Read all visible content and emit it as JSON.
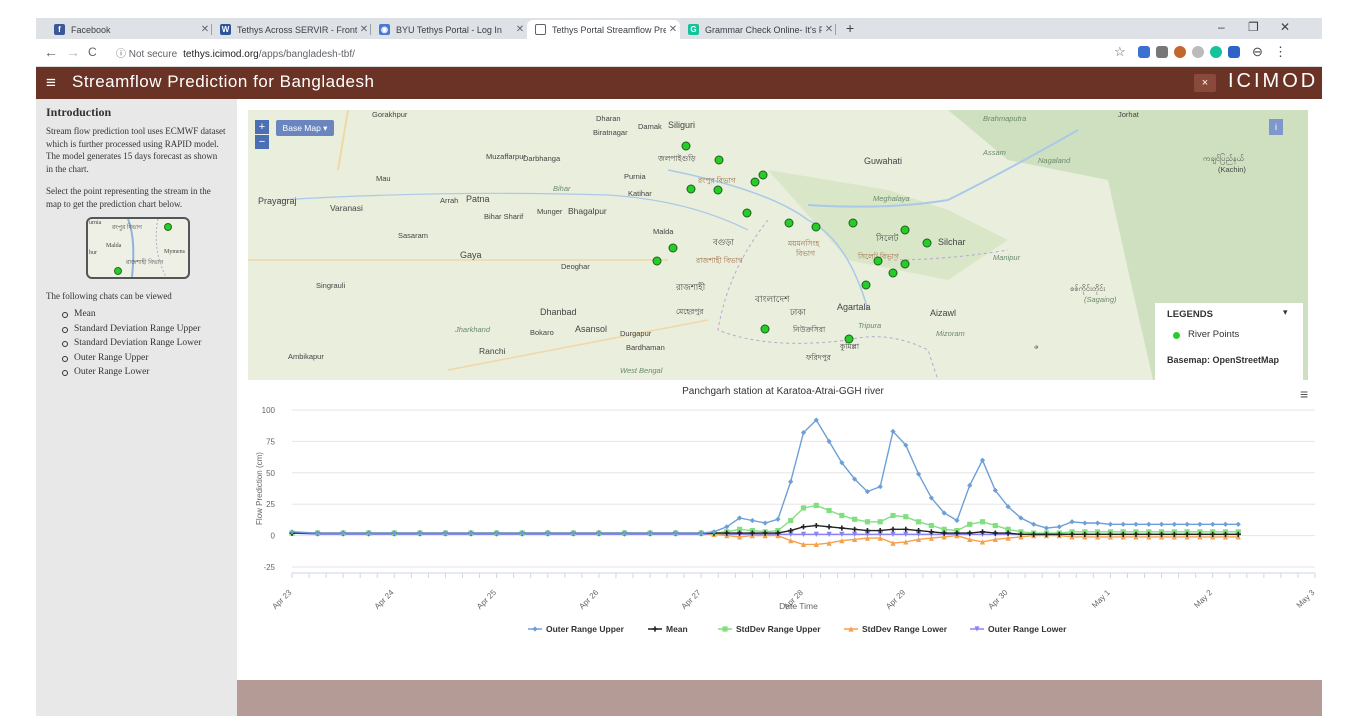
{
  "browser": {
    "tabs": [
      {
        "label": "Facebook",
        "icon": "facebook-icon",
        "color": "#3b5998",
        "glyph": "f"
      },
      {
        "label": "Tethys Across SERVIR - Frontiers",
        "icon": "word-doc-icon",
        "color": "#2b579a",
        "glyph": "W"
      },
      {
        "label": "BYU Tethys Portal - Log In",
        "icon": "globe-icon",
        "color": "#4a7bd0",
        "glyph": "◉"
      },
      {
        "label": "Tethys Portal Streamflow Predicti",
        "icon": "page-icon",
        "color": "#ffffff",
        "glyph": ""
      },
      {
        "label": "Grammar Check Online- It's Free",
        "icon": "grammar-icon",
        "color": "#15c39a",
        "glyph": "G"
      }
    ],
    "new_tab": "+",
    "win_min": "–",
    "win_restore": "❐",
    "win_close": "✕",
    "nav_back": "←",
    "nav_forward": "→",
    "nav_reload": "C",
    "not_secure": "ⓘ Not secure",
    "url_host": "tethys.icimod.org",
    "url_path": "/apps/bangladesh-tbf/",
    "star": "☆",
    "profile": "⊖",
    "kebab": "⋮"
  },
  "app": {
    "menu_glyph": "≡",
    "title": "Streamflow Prediction for Bangladesh",
    "close_glyph": "×",
    "logo": "ICIMOD"
  },
  "sidebar": {
    "heading": "Introduction",
    "para1": "Stream flow prediction tool uses ECMWF dataset which is further processed using RAPID model. The model generates 15 days forecast as shown in the chart.",
    "para2": "Select the point representing the stream in the map to get the prediction chart below.",
    "thumb_labels": [
      "urnia",
      "রংপুর বিভাগ",
      "bur",
      "Malda",
      "রাজশাহী বিভাগ",
      "Mymens"
    ],
    "para3": "The following chats can be viewed",
    "items": [
      "Mean",
      "Standard Deviation Range Upper",
      "Standard Deviation Range Lower",
      "Outer Range Upper",
      "Outer Range Lower"
    ]
  },
  "map": {
    "zoom_in": "+",
    "zoom_out": "−",
    "basemap_button": "Base Map ▾",
    "info_button": "i",
    "legend_title": "LEGENDS",
    "legend_caret": "▾",
    "legend_item": "River Points",
    "basemap_text": "Basemap: OpenStreetMap",
    "point_color": "#27cd27",
    "labels": [
      {
        "t": "Gorakhpur",
        "it": false
      },
      {
        "t": "Dharan",
        "it": false
      },
      {
        "t": "Damak",
        "it": false
      },
      {
        "t": "Siliguri",
        "it": false
      },
      {
        "t": "Biratnagar",
        "it": false
      },
      {
        "t": "Brahmaputra",
        "it": true
      },
      {
        "t": "Jorhat",
        "it": false
      },
      {
        "t": "জলপাইগুড়ি",
        "it": false
      },
      {
        "t": "Muzaffarpur",
        "it": false
      },
      {
        "t": "Darbhanga",
        "it": false
      },
      {
        "t": "Purnia",
        "it": false
      },
      {
        "t": "Guwahati",
        "it": false
      },
      {
        "t": "Assam",
        "it": true
      },
      {
        "t": "Nagaland",
        "it": true
      },
      {
        "t": "Mau",
        "it": false
      },
      {
        "t": "রংপুর বিভাগ",
        "it": false
      },
      {
        "t": "Bihar",
        "it": true
      },
      {
        "t": "Katihar",
        "it": false
      },
      {
        "t": "ကချင်ပြည်နယ်",
        "it": false
      },
      {
        "t": "(Kachin)",
        "it": false
      },
      {
        "t": "Prayagraj",
        "it": false
      },
      {
        "t": "Varanasi",
        "it": false
      },
      {
        "t": "Arrah",
        "it": false
      },
      {
        "t": "Patna",
        "it": false
      },
      {
        "t": "Meghalaya",
        "it": true
      },
      {
        "t": "Bihar Sharif",
        "it": false
      },
      {
        "t": "Munger",
        "it": false
      },
      {
        "t": "Bhagalpur",
        "it": false
      },
      {
        "t": "Sasaram",
        "it": false
      },
      {
        "t": "Malda",
        "it": false
      },
      {
        "t": "বগুড়া",
        "it": false
      },
      {
        "t": "ময়মনসিংহ",
        "it": false
      },
      {
        "t": "বিভাগ",
        "it": false
      },
      {
        "t": "সিলেট",
        "it": false
      },
      {
        "t": "Silchar",
        "it": false
      },
      {
        "t": "Gaya",
        "it": false
      },
      {
        "t": "রাজশাহী বিভাগ",
        "it": false
      },
      {
        "t": "সিলেট বিভাগ",
        "it": false
      },
      {
        "t": "Manipur",
        "it": true
      },
      {
        "t": "Deoghar",
        "it": false
      },
      {
        "t": "Singrauli",
        "it": false
      },
      {
        "t": "রাজশাহী",
        "it": false
      },
      {
        "t": "বাংলাদেশ",
        "it": false
      },
      {
        "t": "Dhanbad",
        "it": false
      },
      {
        "t": "মেহেরপুর",
        "it": false
      },
      {
        "t": "ঢাকা",
        "it": false
      },
      {
        "t": "Agartala",
        "it": false
      },
      {
        "t": "Aizawl",
        "it": false
      },
      {
        "t": "Jharkhand",
        "it": true
      },
      {
        "t": "Bokaro",
        "it": false
      },
      {
        "t": "Asansol",
        "it": false
      },
      {
        "t": "Durgapur",
        "it": false
      },
      {
        "t": "নিউক্রসিরা",
        "it": false
      },
      {
        "t": "Tripura",
        "it": true
      },
      {
        "t": "Mizoram",
        "it": true
      },
      {
        "t": "Ranchi",
        "it": false
      },
      {
        "t": "Bardhaman",
        "it": false
      },
      {
        "t": "কুমিল্লা",
        "it": false
      },
      {
        "t": "Ambikapur",
        "it": false
      },
      {
        "t": "ফরিদপুর",
        "it": false
      },
      {
        "t": "West Bengal",
        "it": true
      },
      {
        "t": "စစ်ကိုင်းတိုင်း",
        "it": false
      },
      {
        "t": "(Sagaing)",
        "it": false
      },
      {
        "t": "ဇ",
        "it": false
      }
    ]
  },
  "chart_data": {
    "type": "line",
    "title": "Panchgarh station at Karatoa-Atrai-GGH river",
    "xlabel": "Date Time",
    "ylabel": "Flow Prediction (cm)",
    "ylim": [
      -25,
      100
    ],
    "yticks": [
      100,
      75,
      50,
      25,
      0,
      -25
    ],
    "x_ticks": [
      "Apr 23",
      "Apr 24",
      "Apr 25",
      "Apr 26",
      "Apr 27",
      "Apr 28",
      "Apr 29",
      "Apr 30",
      "May 1",
      "May 2",
      "May 3"
    ],
    "grid": true,
    "legend": "bottom",
    "menu_glyph": "≡",
    "x_days": [
      0,
      0.25,
      0.5,
      0.75,
      1,
      1.25,
      1.5,
      1.75,
      2,
      2.25,
      2.5,
      2.75,
      3,
      3.25,
      3.5,
      3.75,
      4,
      4.125,
      4.25,
      4.375,
      4.5,
      4.625,
      4.75,
      4.875,
      5,
      5.125,
      5.25,
      5.375,
      5.5,
      5.625,
      5.75,
      5.875,
      6,
      6.125,
      6.25,
      6.375,
      6.5,
      6.625,
      6.75,
      6.875,
      7,
      7.125,
      7.25,
      7.375,
      7.5,
      7.625,
      7.75,
      7.875,
      8,
      8.125,
      8.25,
      8.375,
      8.5,
      8.625,
      8.75,
      8.875,
      9,
      9.125,
      9.25
    ],
    "series": [
      {
        "name": "Outer Range Upper",
        "color": "#6d9fd6",
        "marker": "diamond",
        "values": [
          3,
          2,
          2,
          2,
          2,
          2,
          2,
          2,
          2,
          2,
          2,
          2,
          2,
          2,
          2,
          2,
          2,
          3,
          7,
          14,
          12,
          10,
          13,
          43,
          82,
          92,
          75,
          58,
          45,
          35,
          39,
          83,
          72,
          49,
          30,
          18,
          12,
          40,
          60,
          36,
          23,
          14,
          9,
          6,
          7,
          11,
          10,
          10,
          9,
          9,
          9,
          9,
          9,
          9,
          9,
          9,
          9,
          9,
          9
        ]
      },
      {
        "name": "Mean",
        "color": "#222222",
        "marker": "cross",
        "values": [
          2,
          2,
          2,
          2,
          2,
          2,
          2,
          2,
          2,
          2,
          2,
          2,
          2,
          2,
          2,
          2,
          2,
          2,
          2,
          2,
          2,
          2,
          2,
          4,
          7,
          8,
          7,
          6,
          5,
          4,
          4,
          5,
          5,
          4,
          3,
          2,
          2,
          2,
          3,
          2,
          2,
          1,
          1,
          1,
          1,
          1,
          1,
          1,
          1,
          1,
          1,
          1,
          1,
          1,
          1,
          1,
          1,
          1,
          1
        ]
      },
      {
        "name": "StdDev Range Upper",
        "color": "#80e080",
        "marker": "square",
        "values": [
          2,
          2,
          2,
          2,
          2,
          2,
          2,
          2,
          2,
          2,
          2,
          2,
          2,
          2,
          2,
          2,
          2,
          2,
          3,
          5,
          4,
          3,
          4,
          12,
          22,
          24,
          20,
          16,
          13,
          11,
          11,
          16,
          15,
          11,
          8,
          5,
          4,
          9,
          11,
          8,
          5,
          3,
          2,
          2,
          2,
          3,
          3,
          3,
          3,
          3,
          3,
          3,
          3,
          3,
          3,
          3,
          3,
          3,
          3
        ]
      },
      {
        "name": "StdDev Range Lower",
        "color": "#f5a04a",
        "marker": "triangle",
        "values": [
          2,
          2,
          2,
          2,
          2,
          2,
          2,
          2,
          2,
          2,
          2,
          2,
          2,
          2,
          2,
          2,
          2,
          1,
          0,
          -1,
          0,
          0,
          0,
          -4,
          -7,
          -7,
          -6,
          -4,
          -3,
          -2,
          -2,
          -6,
          -5,
          -3,
          -2,
          -1,
          0,
          -3,
          -5,
          -3,
          -2,
          -1,
          0,
          0,
          0,
          -1,
          -1,
          -1,
          -1,
          -1,
          -1,
          -1,
          -1,
          -1,
          -1,
          -1,
          -1,
          -1,
          -1
        ]
      },
      {
        "name": "Outer Range Lower",
        "color": "#8a84f0",
        "marker": "triangle-down",
        "values": [
          2,
          1,
          1,
          1,
          1,
          1,
          1,
          1,
          1,
          1,
          1,
          1,
          1,
          1,
          1,
          1,
          1,
          1,
          1,
          1,
          1,
          1,
          1,
          1,
          1,
          1,
          1,
          1,
          1,
          1,
          1,
          1,
          1,
          1,
          1,
          1,
          1,
          1,
          1,
          1,
          1,
          1,
          1,
          1,
          1,
          1,
          1,
          1,
          1,
          1,
          1,
          1,
          1,
          1,
          1,
          1,
          1,
          1,
          1
        ]
      }
    ]
  }
}
